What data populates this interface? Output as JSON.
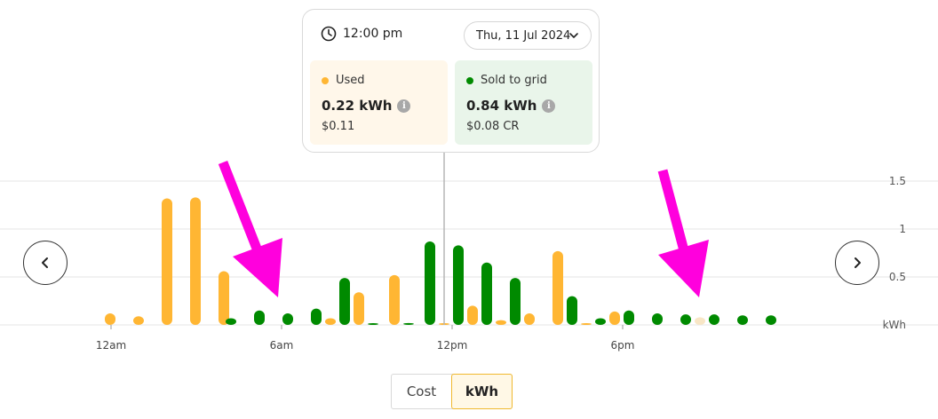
{
  "tooltip": {
    "time": "12:00 pm",
    "date": "Thu, 11 Jul 2024",
    "used": {
      "label": "Used",
      "value": "0.22 kWh",
      "cost": "$0.11",
      "color": "#ffb633"
    },
    "sold": {
      "label": "Sold to grid",
      "value": "0.84 kWh",
      "cost": "$0.08 CR",
      "color": "#008a00"
    }
  },
  "toggle": {
    "cost_label": "Cost",
    "kwh_label": "kWh",
    "selected": "kWh"
  },
  "icons": {
    "clock": "clock-icon",
    "chevron": "chevron-down-icon",
    "info": "info-icon",
    "prev": "chevron-left-icon",
    "next": "chevron-right-icon"
  },
  "colors": {
    "used": "#ffb633",
    "sold": "#008a00",
    "used_faded": "#f8e6c6",
    "annotation": "#ff00dd"
  },
  "chart_data": {
    "type": "bar",
    "unit": "kWh",
    "x_tick_labels": [
      "12am",
      "6am",
      "12pm",
      "6pm"
    ],
    "y_ticks": [
      {
        "value": 0.5,
        "label": "0.5"
      },
      {
        "value": 1,
        "label": "1"
      },
      {
        "value": 1.5,
        "label": "1.5"
      }
    ],
    "y_unit_label": "kWh",
    "ylim": [
      0,
      1.5
    ],
    "selected_hour": 12,
    "series": [
      {
        "name": "Used",
        "color": "#ffb633",
        "points": [
          {
            "hour": 0,
            "value": 0.12
          },
          {
            "hour": 1,
            "value": 0.09
          },
          {
            "hour": 2,
            "value": 1.32
          },
          {
            "hour": 3,
            "value": 1.33
          },
          {
            "hour": 4,
            "value": 0.56
          },
          {
            "hour": 7.75,
            "value": 0.07
          },
          {
            "hour": 8.75,
            "value": 0.34
          },
          {
            "hour": 10,
            "value": 0.52
          },
          {
            "hour": 11.75,
            "value": 0.01
          },
          {
            "hour": 12.75,
            "value": 0.2
          },
          {
            "hour": 13.75,
            "value": 0.05
          },
          {
            "hour": 14.75,
            "value": 0.12
          },
          {
            "hour": 15.75,
            "value": 0.77
          },
          {
            "hour": 16.75,
            "value": 0.01
          },
          {
            "hour": 17.75,
            "value": 0.14
          },
          {
            "hour": 20.75,
            "value": 0.08,
            "faded": true
          }
        ]
      },
      {
        "name": "Sold to grid",
        "color": "#008a00",
        "points": [
          {
            "hour": 4.25,
            "value": 0.07
          },
          {
            "hour": 5.25,
            "value": 0.15
          },
          {
            "hour": 6.25,
            "value": 0.12
          },
          {
            "hour": 7.25,
            "value": 0.17
          },
          {
            "hour": 8.25,
            "value": 0.49
          },
          {
            "hour": 9.25,
            "value": 0.01
          },
          {
            "hour": 10.5,
            "value": 0.02
          },
          {
            "hour": 11.25,
            "value": 0.87
          },
          {
            "hour": 12.25,
            "value": 0.83
          },
          {
            "hour": 13.25,
            "value": 0.65
          },
          {
            "hour": 14.25,
            "value": 0.49
          },
          {
            "hour": 16.25,
            "value": 0.3
          },
          {
            "hour": 17.25,
            "value": 0.07
          },
          {
            "hour": 18.25,
            "value": 0.15
          },
          {
            "hour": 19.25,
            "value": 0.12
          },
          {
            "hour": 20.25,
            "value": 0.11
          },
          {
            "hour": 21.25,
            "value": 0.11
          },
          {
            "hour": 22.25,
            "value": 0.1
          },
          {
            "hour": 23.25,
            "value": 0.1
          }
        ]
      }
    ]
  }
}
